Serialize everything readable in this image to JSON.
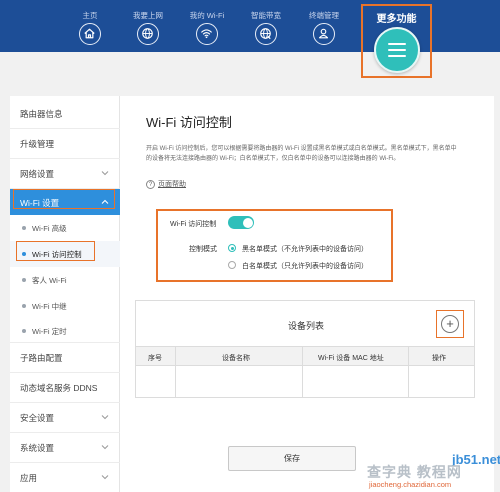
{
  "nav": {
    "items": [
      {
        "label": "主页",
        "icon": "home-icon"
      },
      {
        "label": "我要上网",
        "icon": "globe-icon"
      },
      {
        "label": "我的 Wi-Fi",
        "icon": "wifi-icon"
      },
      {
        "label": "智能带宽",
        "icon": "bandwidth-globe-icon"
      },
      {
        "label": "终端管理",
        "icon": "user-icon"
      }
    ],
    "more_label": "更多功能",
    "more_icon": "menu-icon"
  },
  "sidebar": {
    "items": [
      {
        "label": "路由器信息"
      },
      {
        "label": "升级管理"
      },
      {
        "label": "网络设置"
      },
      {
        "label": "Wi-Fi 设置"
      },
      {
        "label": "子路由配置"
      },
      {
        "label": "动态域名服务 DDNS"
      },
      {
        "label": "安全设置"
      },
      {
        "label": "系统设置"
      },
      {
        "label": "应用"
      }
    ],
    "wifi_sub": [
      {
        "label": "Wi-Fi 高级"
      },
      {
        "label": "Wi-Fi 访问控制"
      },
      {
        "label": "客人 Wi-Fi"
      },
      {
        "label": "Wi-Fi 中继"
      },
      {
        "label": "Wi-Fi 定时"
      }
    ]
  },
  "main": {
    "title": "Wi-Fi 访问控制",
    "desc_line1": "开启 Wi-Fi 访问控制后，您可以根据需要将路由器的 Wi-Fi 设置成黑名单模式或白名单模式。黑名单模式下，黑名单中",
    "desc_line2": "的设备将无法连接路由器的 Wi-Fi；白名单模式下，仅白名单中的设备可以连接路由器的 Wi-Fi。",
    "help_link": "页面帮助",
    "control_label": "Wi-Fi 访问控制",
    "control_enabled": true,
    "mode_label": "控制模式",
    "mode_options": [
      {
        "label": "黑名单模式（不允许列表中的设备访问）",
        "selected": true
      },
      {
        "label": "白名单模式（只允许列表中的设备访问）",
        "selected": false
      }
    ],
    "device_list_title": "设备列表",
    "add_label": "+",
    "table_headers": [
      "序号",
      "设备名称",
      "Wi-Fi 设备 MAC 地址",
      "操作"
    ],
    "save_label": "保存"
  },
  "watermark": {
    "line1": "jb51.net",
    "line2": "查字典 教程网",
    "line3": "jiaocheng.chazidian.com"
  },
  "colors": {
    "topbar": "#1d4e97",
    "accent": "#2e8fdc",
    "teal": "#2fbfba",
    "highlight": "#e8732a"
  }
}
